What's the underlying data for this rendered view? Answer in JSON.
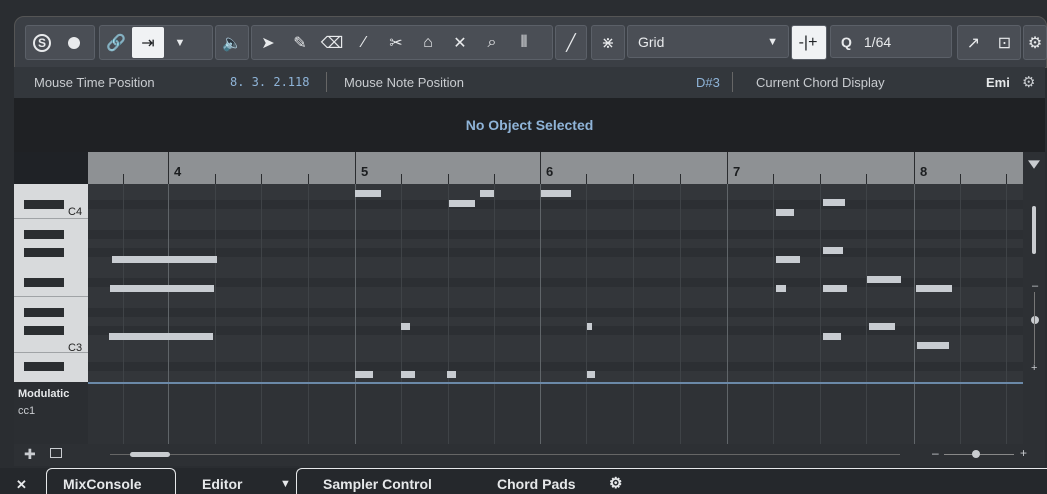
{
  "toolbar": {
    "solo_label": "S",
    "grid_type": "Grid",
    "quantize_label": "Q",
    "quantize_value": "1/64"
  },
  "infoline": {
    "mouse_time_label": "Mouse Time Position",
    "mouse_time_value": "8. 3. 2.118",
    "mouse_note_label": "Mouse Note Position",
    "mouse_note_value": "D#3",
    "chord_label": "Current Chord Display",
    "chord_value": "Emi"
  },
  "status": {
    "message": "No Object Selected"
  },
  "ruler": {
    "bars": [
      "4",
      "5",
      "6",
      "7",
      "8"
    ]
  },
  "keyboard": {
    "c4_label": "C4",
    "c3_label": "C3"
  },
  "controller": {
    "lane_name": "Modulatic",
    "cc_label": "cc1"
  },
  "tabs": {
    "close": "✕",
    "mixconsole": "MixConsole",
    "editor": "Editor",
    "sampler_control": "Sampler Control",
    "chord_pads": "Chord Pads"
  },
  "colors": {
    "note": "#c8ccd1",
    "status_text": "#8fb4d8",
    "ruler": "#8e9194"
  }
}
